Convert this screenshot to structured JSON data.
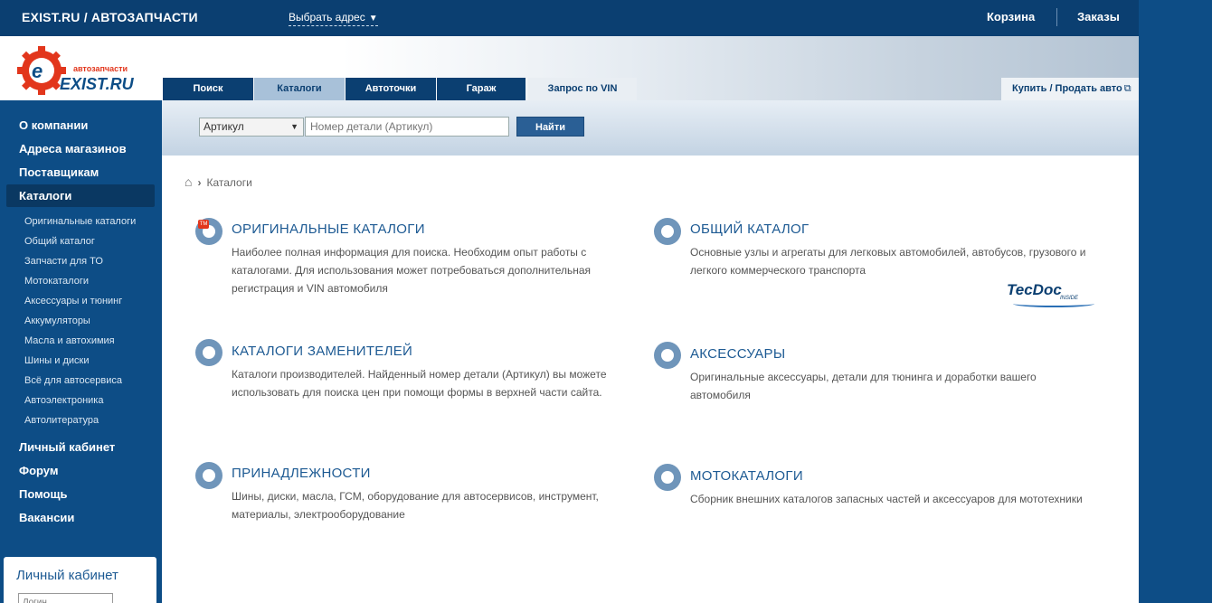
{
  "topbar": {
    "brand": "EXIST.RU / АВТОЗАПЧАСТИ",
    "address_link": "Выбрать адрес",
    "cart": "Корзина",
    "orders": "Заказы"
  },
  "logo": {
    "subtitle": "автозапчасти",
    "name": "EXIST.RU"
  },
  "tabs": [
    {
      "label": "Поиск"
    },
    {
      "label": "Каталоги"
    },
    {
      "label": "Автоточки"
    },
    {
      "label": "Гараж"
    },
    {
      "label": "Запрос по VIN"
    }
  ],
  "buy_link": "Купить / Продать авто",
  "search": {
    "select_value": "Артикул",
    "placeholder": "Номер детали (Артикул)",
    "button": "Найти"
  },
  "breadcrumb": {
    "current": "Каталоги"
  },
  "sidebar": {
    "main_top": [
      "О компании",
      "Адреса магазинов",
      "Поставщикам",
      "Каталоги"
    ],
    "sub": [
      "Оригинальные каталоги",
      "Общий каталог",
      "Запчасти для ТО",
      "Мотокаталоги",
      "Аксессуары и тюнинг",
      "Аккумуляторы",
      "Масла и автохимия",
      "Шины и диски",
      "Всё для автосервиса",
      "Автоэлектроника",
      "Автолитература"
    ],
    "main_bottom": [
      "Личный кабинет",
      "Форум",
      "Помощь",
      "Вакансии"
    ]
  },
  "account_box": {
    "title": "Личный кабинет",
    "login_placeholder": "Логин"
  },
  "cards": [
    {
      "title": "ОРИГИНАЛЬНЫЕ КАТАЛОГИ",
      "desc1": "Наиболее полная информация для поиска. Необходим опыт работы с",
      "desc2": "каталогами. Для использования может потребоваться дополнительная",
      "desc3": "регистрация и VIN автомобиля",
      "badge": "TM"
    },
    {
      "title": "ОБЩИЙ КАТАЛОГ",
      "desc1": "Основные узлы и агрегаты для легковых автомобилей, автобусов, грузового и",
      "desc2": "легкого коммерческого транспорта",
      "logo": "TecDoc",
      "logo_sub": "INSIDE"
    },
    {
      "title": "КАТАЛОГИ ЗАМЕНИТЕЛЕЙ",
      "desc1": "Каталоги производителей. Найденный номер детали (Артикул) вы можете",
      "desc2": "использовать для поиска цен при помощи формы в верхней части сайта."
    },
    {
      "title": "АКСЕССУАРЫ",
      "desc1": "Оригинальные аксессуары, детали для тюнинга и доработки вашего",
      "desc2": "автомобиля"
    },
    {
      "title": "ПРИНАДЛЕЖНОСТИ",
      "desc1": "Шины, диски, масла, ГСМ, оборудование для автосервисов, инструмент,",
      "desc2": "материалы, электрооборудование"
    },
    {
      "title": "МОТОКАТАЛОГИ",
      "desc1": "Сборник внешних каталогов запасных частей и аксессуаров для мототехники"
    }
  ]
}
